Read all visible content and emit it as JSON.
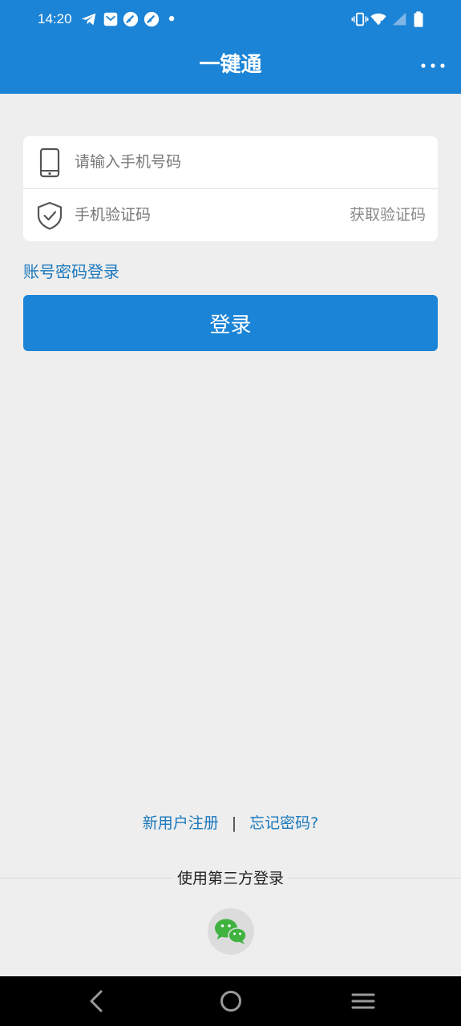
{
  "status_bar": {
    "time": "14:20",
    "left_icons": [
      "telegram-icon",
      "mail-icon",
      "speedometer-icon",
      "speedometer-icon",
      "dot-icon"
    ],
    "right_icons": [
      "vibrate-icon",
      "wifi-icon",
      "signal-icon",
      "battery-icon"
    ]
  },
  "header": {
    "title": "一键通",
    "more_icon": "more-horizontal-icon"
  },
  "form": {
    "phone_placeholder": "请输入手机号码",
    "code_placeholder": "手机验证码",
    "get_code": "获取验证码",
    "phone_icon": "phone-icon",
    "code_icon": "shield-check-icon"
  },
  "account_login": "账号密码登录",
  "login_button": "登录",
  "bottom_links": {
    "register": "新用户注册",
    "separator": "|",
    "forgot": "忘记密码?"
  },
  "third_party": {
    "label": "使用第三方登录",
    "wechat_icon": "wechat-icon"
  },
  "nav": {
    "icons": [
      "back-icon",
      "home-icon",
      "menu-icon"
    ]
  },
  "colors": {
    "brand_blue": "#1c84d6",
    "link_blue": "#1b78bd",
    "background": "#eeeeee",
    "wechat_green": "#3fb23f"
  }
}
